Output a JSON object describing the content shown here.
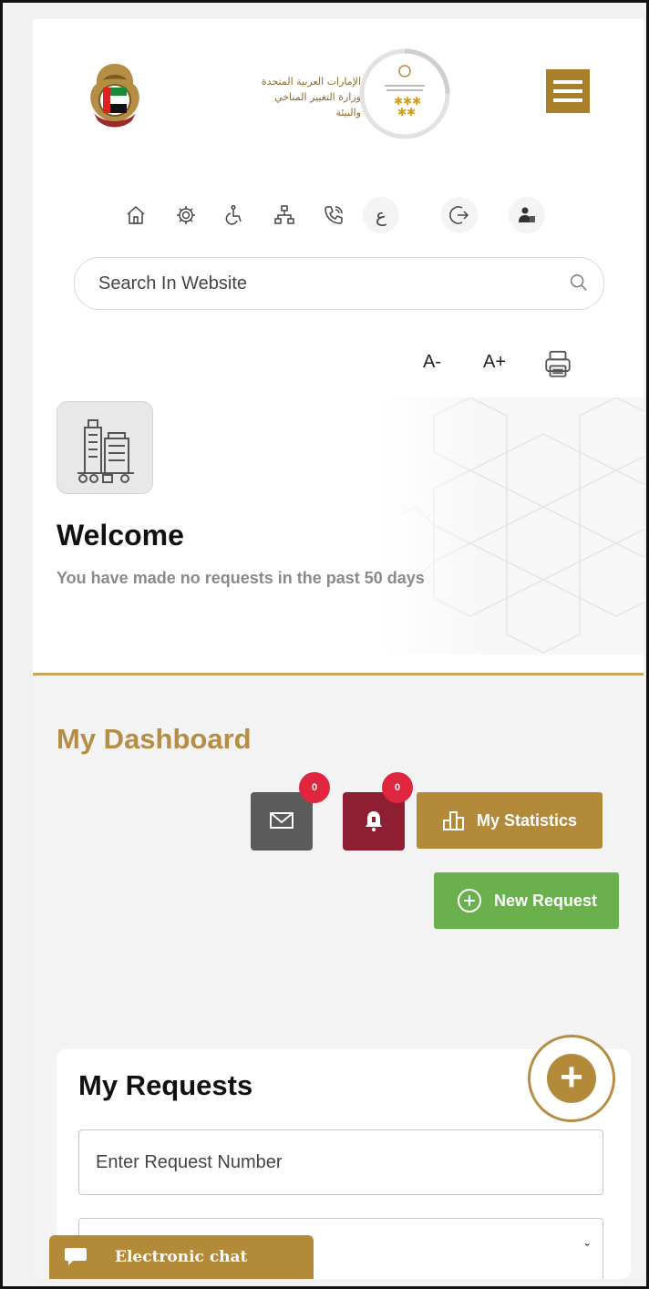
{
  "header": {
    "logo_text_line1": "الإمارات العربية المتحدة",
    "logo_text_line2": "وزارة التغيير المناخي",
    "logo_text_line3": "والبيئة",
    "menu_icon": "hamburger-icon"
  },
  "toolbar_icons": [
    "home-icon",
    "settings-icon",
    "accessibility-icon",
    "sitemap-icon",
    "phone-icon",
    "arabic-language-icon",
    "logout-icon",
    "user-profile-icon"
  ],
  "toolbar": {
    "language_label": "ع"
  },
  "search": {
    "placeholder": "Search In Website"
  },
  "font_controls": {
    "decrease": "A-",
    "increase": "A+"
  },
  "welcome": {
    "title": "Welcome",
    "subtitle": "You have made no requests in the past 50 days"
  },
  "dashboard": {
    "title": "My Dashboard",
    "mail_count": "0",
    "notification_count": "0",
    "stats_label": "My Statistics",
    "new_request_label": "New Request"
  },
  "requests": {
    "title": "My Requests",
    "request_number_placeholder": "Enter Request Number",
    "select_value": ""
  },
  "chat": {
    "label": "Electronic chat"
  },
  "colors": {
    "gold": "#b38a3a",
    "mail_button": "#5b5b5b",
    "bell_button": "#8e1e32",
    "badge": "#e0263f",
    "new_request": "#6ab04c"
  }
}
